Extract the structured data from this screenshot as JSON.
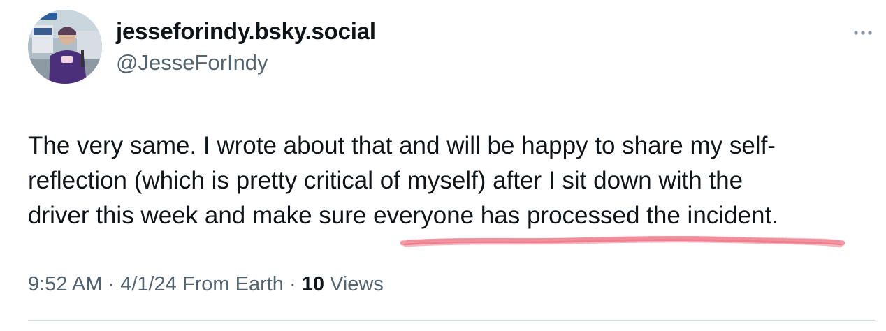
{
  "author": {
    "display_name": "jesseforindy.bsky.social",
    "handle": "@JesseForIndy",
    "avatar_icon": "profile-photo"
  },
  "more_icon": "ellipsis-icon",
  "tweet": {
    "lines": [
      "The very same.  I wrote about that and will be happy to share my self-",
      "reflection (which is pretty critical of myself) after I sit down with the",
      "driver this week and make sure everyone has processed the incident."
    ],
    "highlight_color": "#e8485f"
  },
  "meta": {
    "time": "9:52 AM",
    "sep1": " · ",
    "date": "4/1/24",
    "source": " From Earth",
    "sep2": " · ",
    "views_count": "10",
    "views_label": " Views"
  },
  "colors": {
    "text_primary": "#0f1419",
    "text_secondary": "#536471",
    "divider": "#cfd9de"
  }
}
